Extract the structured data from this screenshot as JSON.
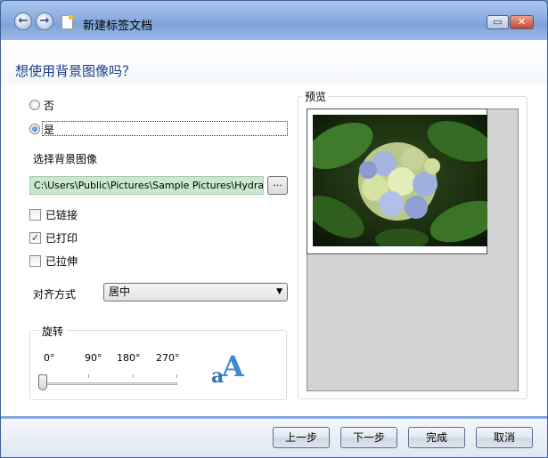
{
  "window": {
    "title": "新建标签文档",
    "back_glyph": "←",
    "forward_glyph": "→",
    "restore_glyph": "▭",
    "close_glyph": "✕"
  },
  "page": {
    "title": "想使用背景图像吗？"
  },
  "options": {
    "no_label": "否",
    "yes_label": "是",
    "selected": "是"
  },
  "background": {
    "select_label": "选择背景图像",
    "path": "C:\\Users\\Public\\Pictures\\Sample Pictures\\Hydrangeas.jpg",
    "browse_label": "..."
  },
  "checks": [
    {
      "label": "已链接",
      "checked": false
    },
    {
      "label": "已打印",
      "checked": true
    },
    {
      "label": "已拉伸",
      "checked": false
    }
  ],
  "check_mark": "✓",
  "alignment": {
    "label": "对齐方式",
    "value": "居中",
    "arrow": "▼"
  },
  "rotation": {
    "legend": "旋转",
    "ticks": [
      "0°",
      "90°",
      "180°",
      "270°"
    ],
    "value": "0°",
    "icon_letter_small": "a",
    "icon_letter_large": "A"
  },
  "preview": {
    "legend": "预览"
  },
  "footer": {
    "back": "上一步",
    "next": "下一步",
    "finish": "完成",
    "cancel": "取消"
  },
  "colors": {
    "title_blue": "#1f3b8a",
    "path_green": "#c9e8cd",
    "preview_gray": "#d3d3d3"
  }
}
